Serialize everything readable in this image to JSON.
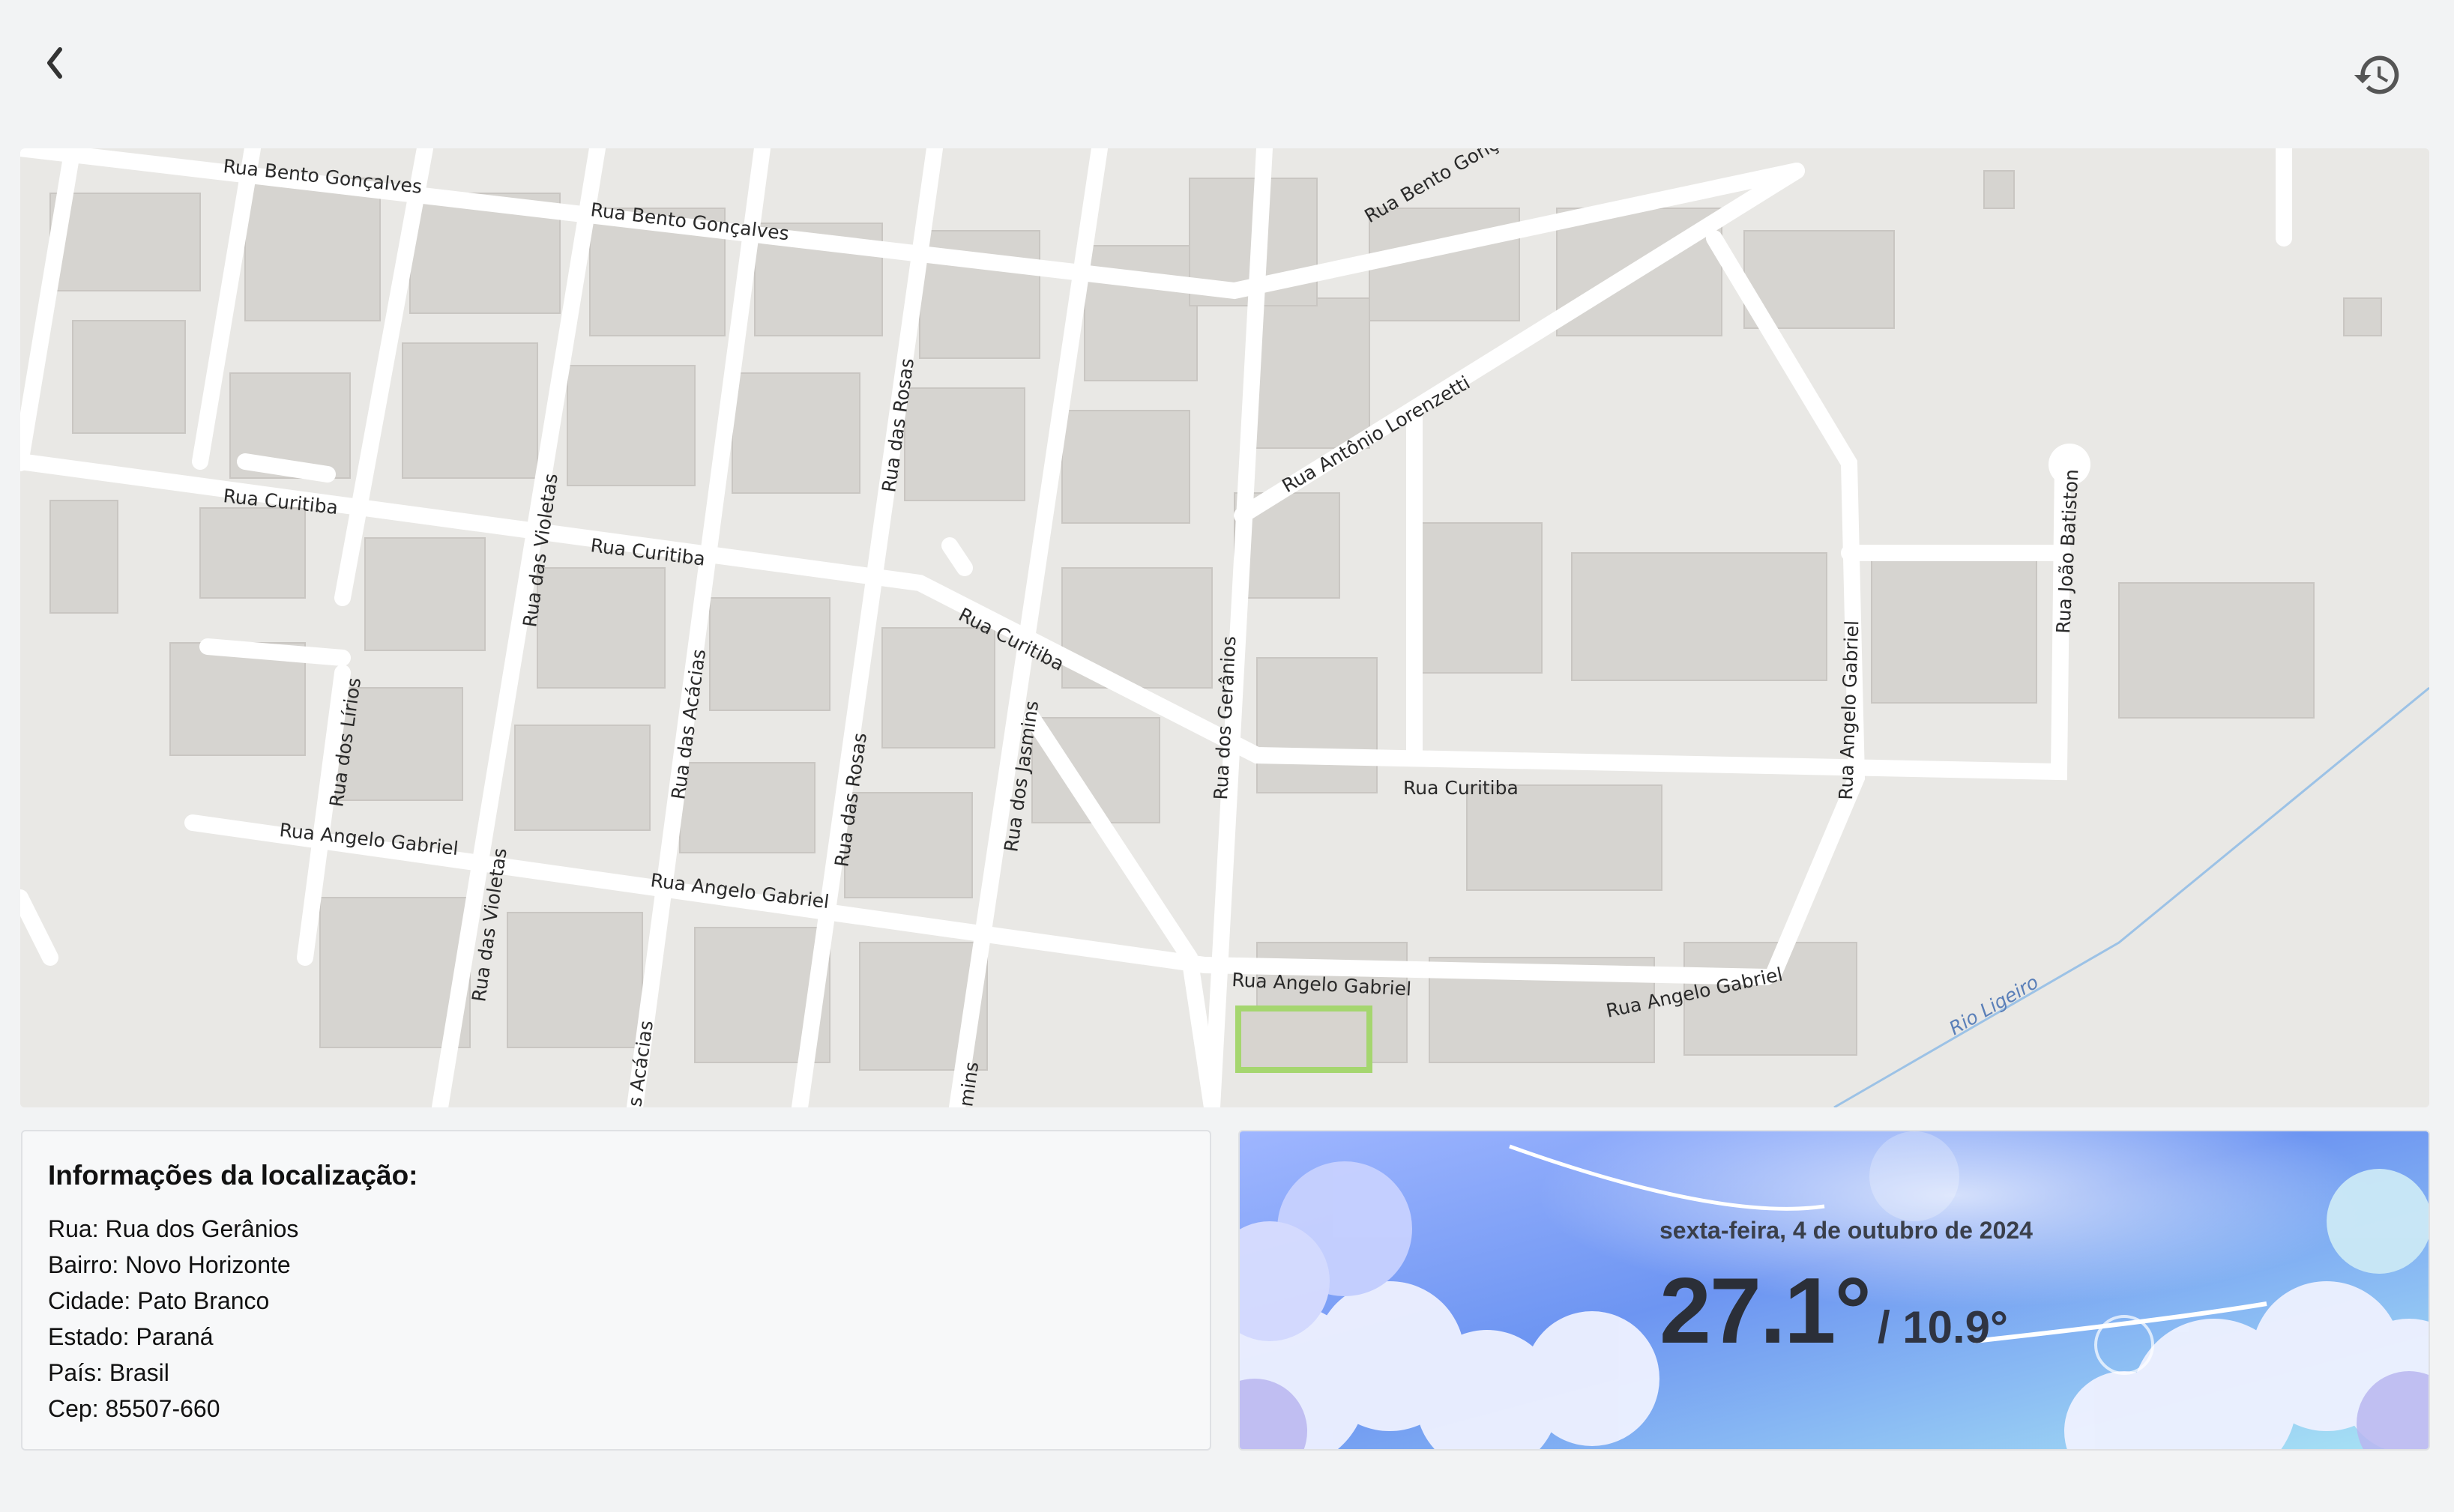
{
  "nav": {
    "back_icon": "chevron-left-icon",
    "history_icon": "history-icon"
  },
  "map": {
    "streets": {
      "bento1": "Rua Bento Gonçalves",
      "bento2": "Rua Bento Gonçalves",
      "bento3": "Rua Bento Gonç",
      "curitiba1": "Rua Curitiba",
      "curitiba2": "Rua Curitiba",
      "curitiba3": "Rua Curitiba",
      "curitiba4": "Rua Curitiba",
      "antonio": "Rua Antônio Lorenzetti",
      "rosas1": "Rua das Rosas",
      "rosas2": "Rua das Rosas",
      "violetas1": "Rua das Violetas",
      "violetas2": "Rua das Violetas",
      "acacias1": "Rua das Acácias",
      "acacias2": "s Acácias",
      "lirios": "Rua dos Lírios",
      "jasmins1": "Rua dos Jasmins",
      "jasmins2": "mins",
      "geranios": "Rua dos Gerânios",
      "angelo1": "Rua Angelo Gabriel",
      "angelo2": "Rua Angelo Gabriel",
      "angelo3": "Rua Angelo Gabriel",
      "angelo4": "Rua Angelo Gabriel",
      "angelo_v": "Rua Angelo Gabriel",
      "joao": "Rua João Batiston",
      "rio": "Rio Ligeiro"
    }
  },
  "location": {
    "title": "Informações da localização:",
    "lines": [
      "Rua: Rua dos Gerânios",
      "Bairro: Novo Horizonte",
      "Cidade: Pato Branco",
      "Estado: Paraná",
      "País: Brasil",
      "Cep: 85507-660"
    ]
  },
  "weather": {
    "date": "sexta-feira, 4 de outubro de 2024",
    "temp_max": "27.1°",
    "temp_min": "/ 10.9°"
  }
}
